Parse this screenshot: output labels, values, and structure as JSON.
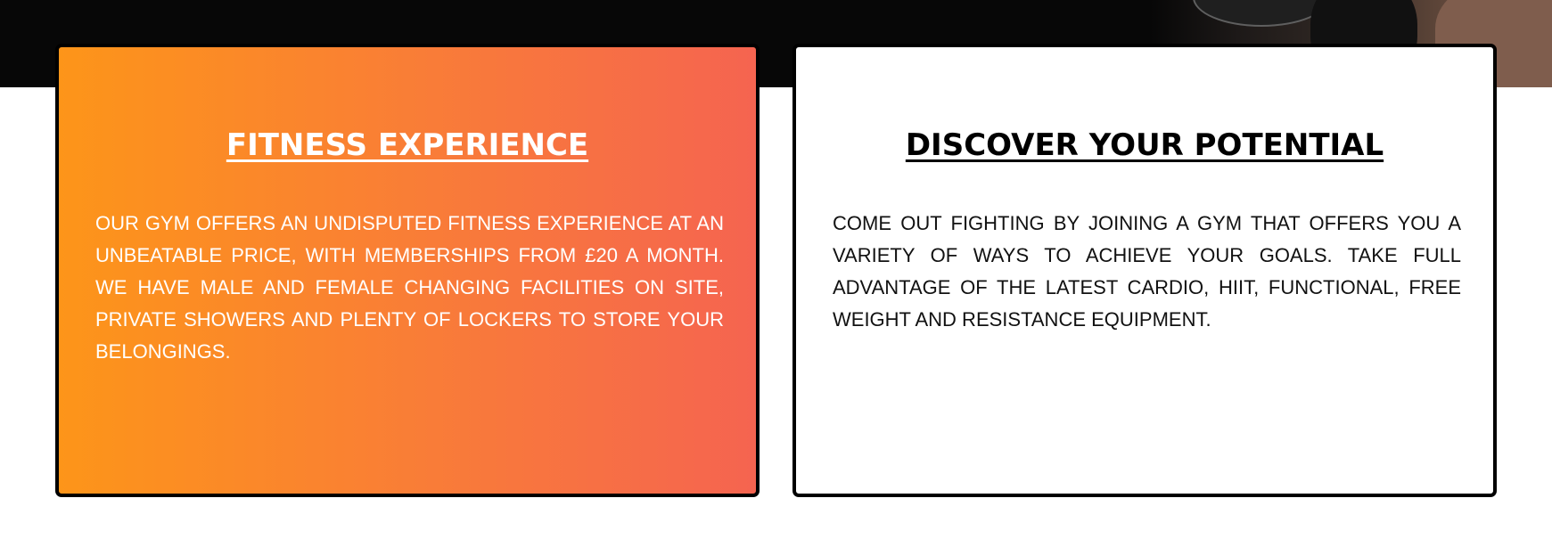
{
  "page": {
    "background_color": "#ffffff",
    "hero_strip_color": "#070707"
  },
  "cards": [
    {
      "title": "FITNESS EXPERIENCE",
      "body": "OUR GYM OFFERS AN UNDISPUTED FITNESS EXPERIENCE AT AN UNBEATABLE PRICE, WITH MEMBERSHIPS FROM £20 A MONTH. WE HAVE MALE AND FEMALE CHANGING FACILITIES ON SITE, PRIVATE SHOWERS AND PLENTY OF LOCKERS TO STORE YOUR BELONGINGS.",
      "colors": {
        "gradient_start": "#fd9519",
        "gradient_end": "#f56450",
        "text": "#ffffff",
        "border": "#000000"
      }
    },
    {
      "title": "DISCOVER YOUR POTENTIAL",
      "body": "COME OUT FIGHTING BY JOINING A GYM THAT OFFERS YOU A VARIETY OF WAYS TO ACHIEVE YOUR GOALS. TAKE FULL ADVANTAGE OF THE LATEST CARDIO, HIIT, FUNCTIONAL, FREE WEIGHT AND RESISTANCE EQUIPMENT.",
      "colors": {
        "background": "#ffffff",
        "text": "#000000",
        "border": "#000000"
      }
    }
  ]
}
